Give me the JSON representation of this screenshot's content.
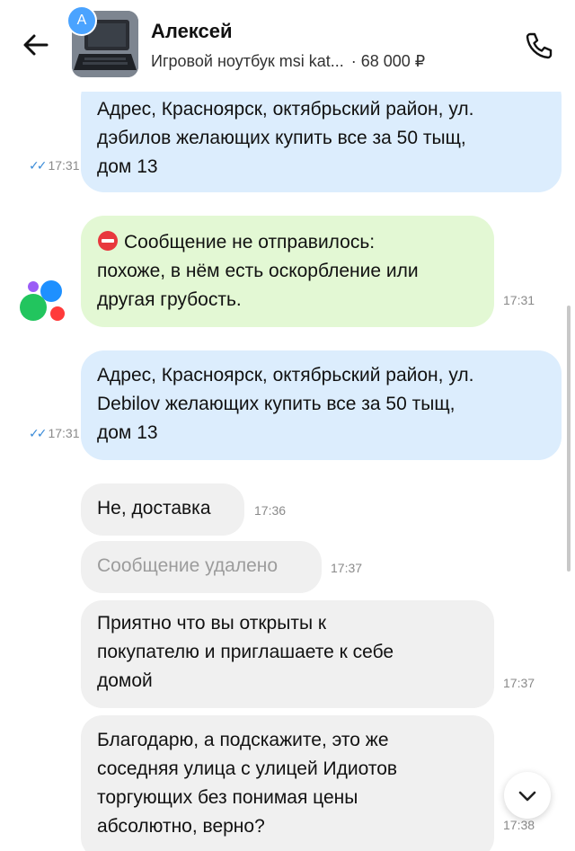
{
  "header": {
    "avatar_letter": "А",
    "name": "Алексей",
    "listing": "Игровой ноутбук msi kat...",
    "price": "· 68 000 ₽"
  },
  "messages": [
    {
      "type": "outgoing",
      "text_lines": [
        "Адрес, Красноярск, октябрьский район, ул.",
        "дэбилов желающих купить все за 50 тыщ,",
        "дом 13"
      ],
      "time": "17:31",
      "status": "read"
    },
    {
      "type": "system",
      "text_lines": [
        "Сообщение не отправилось:",
        "похоже, в нём есть оскорбление или",
        "другая грубость."
      ],
      "time": "17:31"
    },
    {
      "type": "outgoing",
      "text_lines": [
        "Адрес, Красноярск, октябрьский район, ул.",
        "Debilov желающих купить все за 50 тыщ,",
        "дом 13"
      ],
      "time": "17:31",
      "status": "read"
    },
    {
      "type": "incoming",
      "text": "Не, доставка",
      "time": "17:36"
    },
    {
      "type": "incoming_deleted",
      "text": "Сообщение удалено",
      "time": "17:37"
    },
    {
      "type": "incoming",
      "text_lines": [
        "Приятно что вы открыты к",
        "покупателю и приглашаете к себе",
        "домой"
      ],
      "time": "17:37"
    },
    {
      "type": "incoming",
      "text_lines": [
        "Благодарю, а подскажите, это же",
        "соседняя улица с улицей Идиотов",
        "торгующих без понимая цены",
        "абсолютно, верно?"
      ],
      "time": "17:38"
    }
  ],
  "colors": {
    "outgoing_bubble": "#dcedfd",
    "system_bubble": "#e3f8d4",
    "incoming_bubble": "#f0f0f0",
    "error_icon": "#e8383d",
    "read_check": "#3a8bd8"
  },
  "icons": [
    "back-arrow-icon",
    "phone-icon",
    "check-double-icon",
    "stop-error-icon",
    "service-logo-icon",
    "chevron-down-icon"
  ]
}
